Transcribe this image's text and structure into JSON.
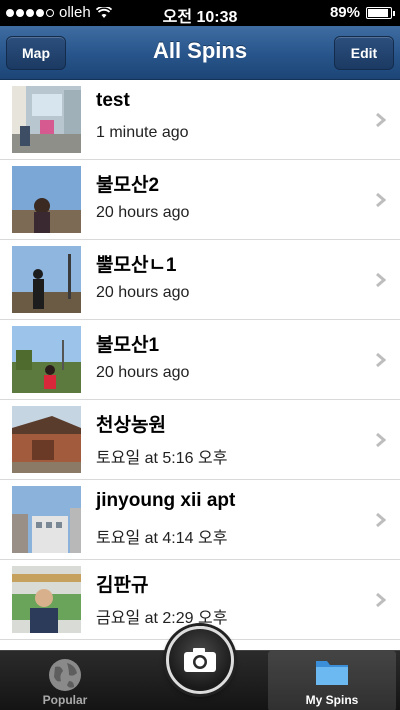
{
  "status_bar": {
    "carrier": "olleh",
    "time": "오전 10:38",
    "battery": "89%",
    "battery_level": 0.89
  },
  "nav": {
    "title": "All Spins",
    "left_button": "Map",
    "right_button": "Edit"
  },
  "spins": [
    {
      "name": "test",
      "time": "1 minute ago"
    },
    {
      "name": "불모산2",
      "time": "20 hours ago"
    },
    {
      "name": "뿔모산ㄴ1",
      "time": "20 hours ago"
    },
    {
      "name": "불모산1",
      "time": "20 hours ago"
    },
    {
      "name": "천상농원",
      "time": "토요일 at 5:16 오후"
    },
    {
      "name": "jinyoung xii apt",
      "time": "토요일 at 4:14 오후"
    },
    {
      "name": "김판규",
      "time": "금요일 at 2:29 오후"
    }
  ],
  "tab_bar": {
    "popular": "Popular",
    "my_spins": "My Spins",
    "selected": "my_spins"
  },
  "colors": {
    "nav_blue": "#27548a",
    "tab_dark": "#141414"
  }
}
